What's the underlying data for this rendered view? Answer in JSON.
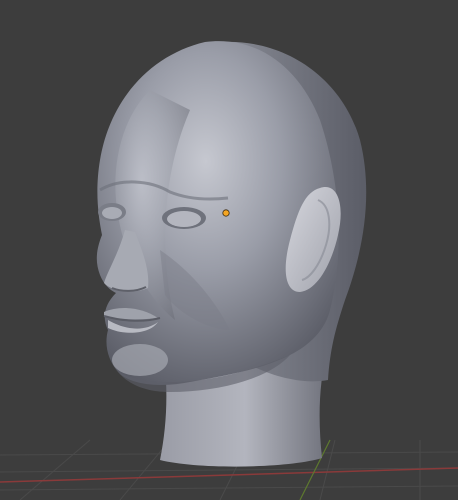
{
  "viewport": {
    "background_color": "#3d3d3d",
    "grid_line_color": "#4a4a4a",
    "x_axis_color": "#8a3a3a",
    "y_axis_color": "#5d7a2e"
  },
  "model": {
    "name": "head-sculpt-mesh",
    "shading": "matcap-gray",
    "base_color": "#8c8f9a",
    "highlight_color": "#c9cbd3",
    "shadow_color": "#4c4e57"
  },
  "origin_marker": {
    "color": "#f5a623",
    "icon": "object-origin-dot"
  }
}
